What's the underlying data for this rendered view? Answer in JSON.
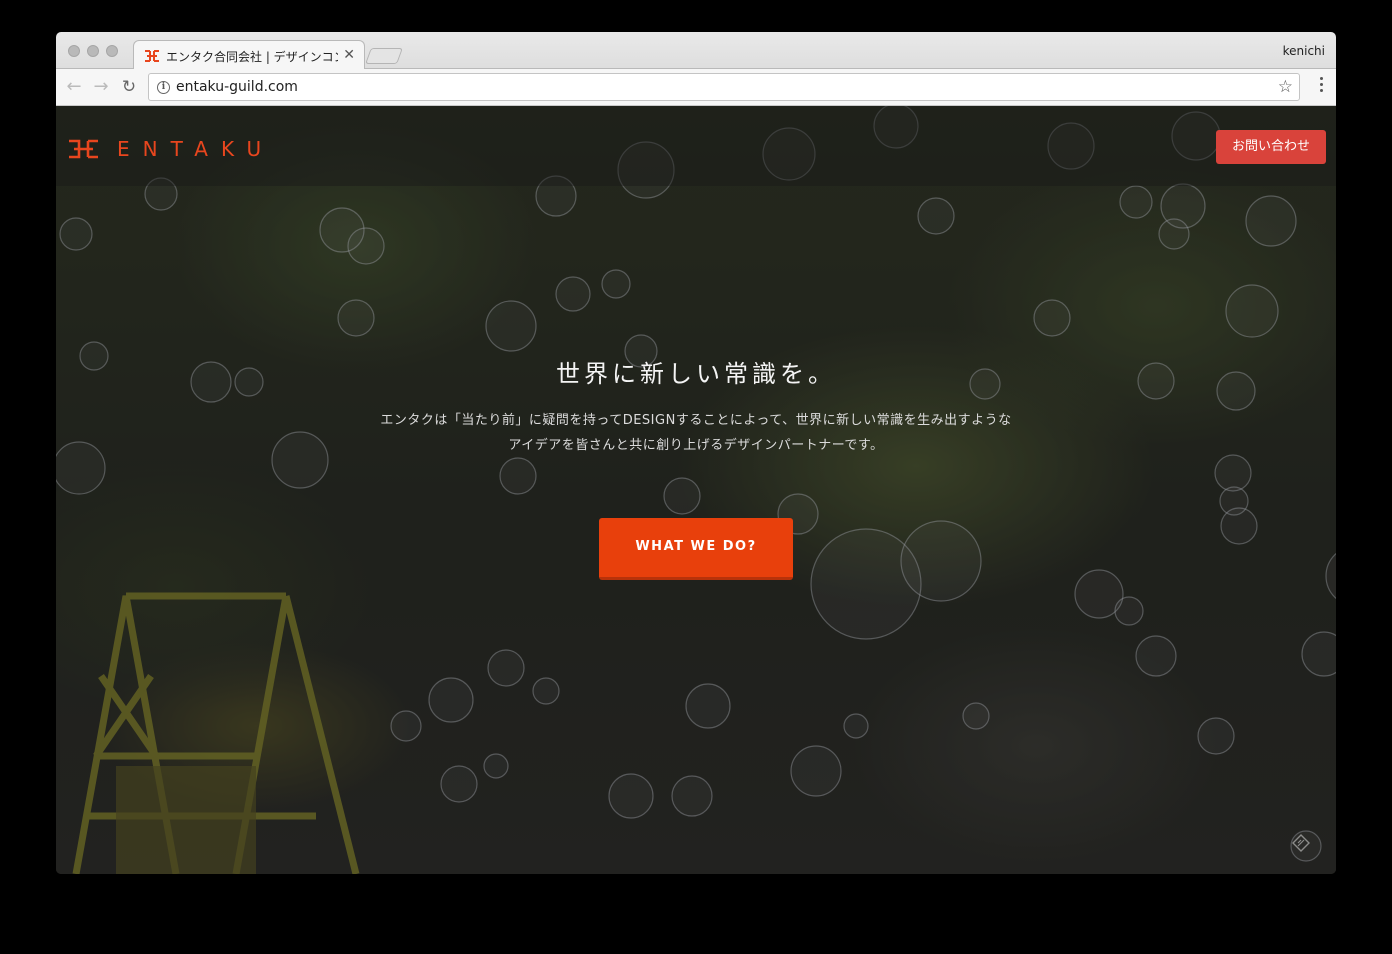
{
  "browser": {
    "tab_title": "エンタク合同会社 | デザインコンサ",
    "tab_close": "✕",
    "profile_name": "kenichi",
    "url": "entaku-guild.com",
    "back_icon": "←",
    "forward_icon": "→",
    "reload_icon": "↻",
    "bookmark_icon": "☆",
    "info_icon": "i"
  },
  "site": {
    "logo_text": "ENTAKU",
    "contact_button": "お問い合わせ",
    "hero_title": "世界に新しい常識を。",
    "hero_description": "エンタクは「当たり前」に疑問を持ってDESIGNすることによって、世界に新しい常識を生み出すようなアイデアを皆さんと共に創り上げるデザインパートナーです。",
    "cta_button": "WHAT WE DO?"
  },
  "colors": {
    "brand": "#e8461e",
    "cta": "#e8400c",
    "contact": "#d9433b"
  }
}
